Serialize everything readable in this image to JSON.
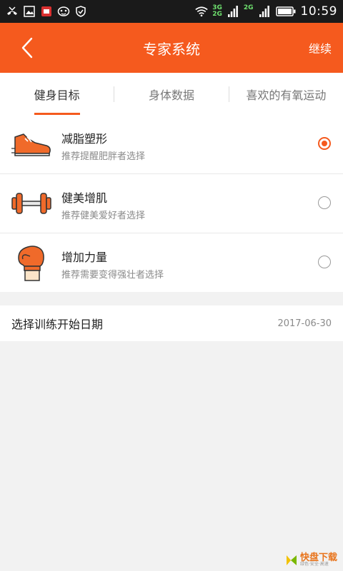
{
  "status_bar": {
    "time": "10:59",
    "network_top": "3G",
    "network_bottom": "2G",
    "network_right": "2G",
    "icons": [
      "missed-call-icon",
      "gallery-icon",
      "app-notification-icon",
      "mask-icon",
      "shield-icon",
      "wifi-icon",
      "signal-icon",
      "battery-icon"
    ]
  },
  "header": {
    "title": "专家系统",
    "action_label": "继续",
    "back_icon": "chevron-left-icon",
    "color": "#f55a1e"
  },
  "tabs": [
    {
      "label": "健身目标",
      "active": true
    },
    {
      "label": "身体数据",
      "active": false
    },
    {
      "label": "喜欢的有氧运动",
      "active": false
    }
  ],
  "goals": [
    {
      "title": "减脂塑形",
      "subtitle": "推荐提醒肥胖者选择",
      "icon": "running-shoe-icon",
      "selected": true
    },
    {
      "title": "健美增肌",
      "subtitle": "推荐健美爱好者选择",
      "icon": "dumbbell-icon",
      "selected": false
    },
    {
      "title": "增加力量",
      "subtitle": "推荐需要变得强壮者选择",
      "icon": "boxing-glove-icon",
      "selected": false
    }
  ],
  "start_date": {
    "label": "选择训练开始日期",
    "value": "2017-06-30"
  },
  "watermark": {
    "brand": "快盘下载",
    "tagline": "绿色·安全·高速"
  }
}
